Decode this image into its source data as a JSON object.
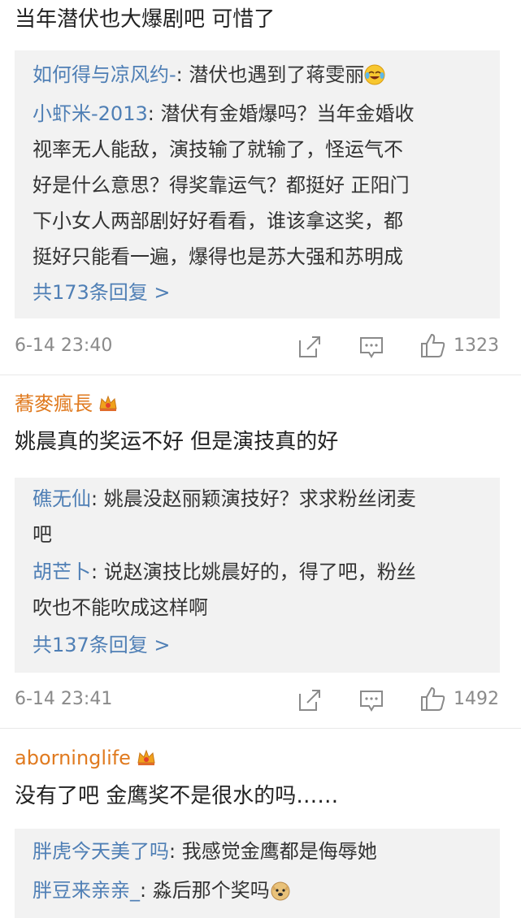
{
  "comments": [
    {
      "text": "当年潜伏也大爆剧吧 可惜了",
      "replies": [
        {
          "user": "如何得与凉风约-",
          "text": ": 潜伏也遇到了蒋雯丽"
        },
        {
          "user": "小虾米-2013",
          "text_lines": [
            ": 潜伏有金婚爆吗？当年金婚收",
            "视率无人能敌，演技输了就输了，怪运气不",
            "好是什么意思？得奖靠运气？都挺好 正阳门",
            "下小女人两部剧好好看看，谁该拿这奖，都",
            "挺好只能看一遍，爆得也是苏大强和苏明成"
          ]
        }
      ],
      "more_replies": "共173条回复 >",
      "time": "6-14 23:40",
      "likes": "1323"
    },
    {
      "user": "蕎麥瘋長",
      "text": "姚晨真的奖运不好 但是演技真的好",
      "replies": [
        {
          "user": "礁无仙",
          "text_lines": [
            ": 姚晨没赵丽颖演技好？求求粉丝闭麦",
            "吧"
          ]
        },
        {
          "user": "胡芒卜",
          "text_lines": [
            ": 说赵演技比姚晨好的，得了吧，粉丝",
            "吹也不能吹成这样啊"
          ]
        }
      ],
      "more_replies": "共137条回复 >",
      "time": "6-14 23:41",
      "likes": "1492"
    },
    {
      "user": "aborninglife",
      "text": "没有了吧 金鹰奖不是很水的吗……",
      "replies": [
        {
          "user": "胖虎今天美了吗",
          "text": ": 我感觉金鹰都是侮辱她"
        },
        {
          "user": "胖豆来亲亲_",
          "text": ": 淼后那个奖吗"
        }
      ]
    }
  ],
  "colors": {
    "username": "#e07a1f",
    "reply_user": "#4f7fb5",
    "meta": "#8a8a8a",
    "reply_bg": "#f2f2f2"
  },
  "icons": [
    "share-icon",
    "comment-icon",
    "like-icon",
    "crown-badge-icon",
    "laugh-cry-emoji",
    "doge-emoji"
  ]
}
